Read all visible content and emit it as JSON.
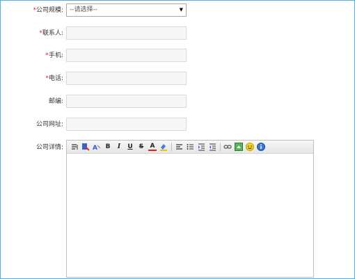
{
  "form": {
    "required_mark": "*",
    "scale": {
      "label": "公司规模:",
      "selected": "--请选择--"
    },
    "contact": {
      "label": "联系人:",
      "value": ""
    },
    "mobile": {
      "label": "手机:",
      "value": ""
    },
    "phone": {
      "label": "电话:",
      "value": ""
    },
    "postcode": {
      "label": "邮编:",
      "value": ""
    },
    "website": {
      "label": "公司网址:",
      "value": ""
    },
    "details": {
      "label": "公司详情:"
    }
  },
  "toolbar": {
    "icons": [
      "source-icon",
      "paste-word-icon",
      "select-all-icon",
      "bold-icon",
      "italic-icon",
      "underline-icon",
      "strikethrough-icon",
      "font-color-icon",
      "highlight-icon",
      "align-icon",
      "list-icon",
      "indent-icon",
      "outdent-icon",
      "link-icon",
      "image-icon",
      "emoticon-icon",
      "about-icon"
    ],
    "bold": "B",
    "italic": "I",
    "underline": "U",
    "strike": "S",
    "font_color": "A"
  },
  "colors": {
    "border": "#5aa9dd",
    "required": "#e0201b",
    "field_bg": "#f7f7f7"
  }
}
